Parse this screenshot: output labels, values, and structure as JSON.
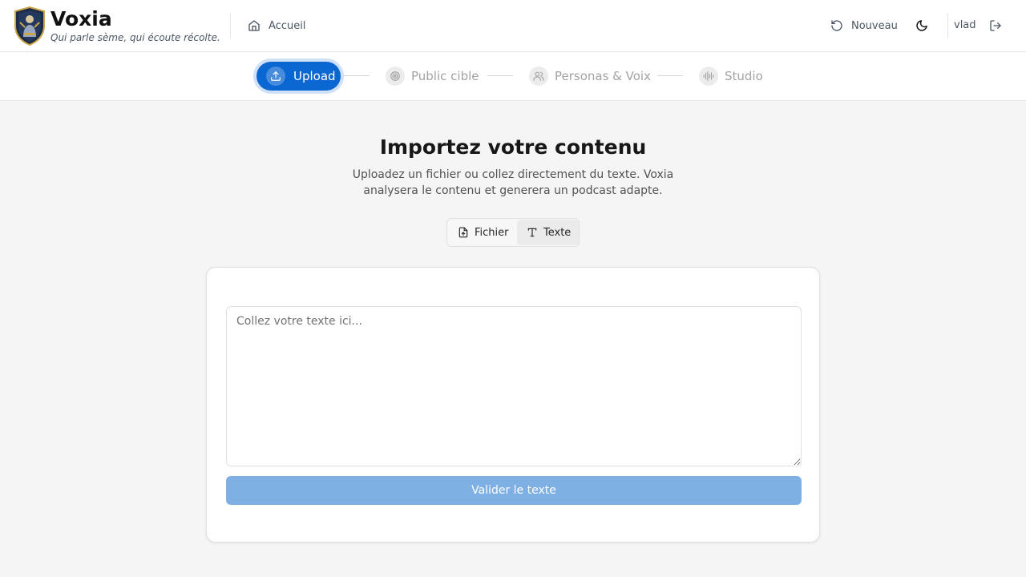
{
  "brand": {
    "name": "Voxia",
    "tagline": "Qui parle sème, qui écoute récolte.",
    "logo_icon": "shield-logo-icon"
  },
  "header": {
    "home_label": "Accueil",
    "home_icon": "home-icon",
    "new_label": "Nouveau",
    "new_icon": "refresh-icon",
    "theme_icon": "moon-icon",
    "user_name": "vlad",
    "logout_icon": "logout-icon"
  },
  "stepper": {
    "steps": [
      {
        "label": "Upload",
        "icon": "upload-icon",
        "state": "active"
      },
      {
        "label": "Public cible",
        "icon": "target-icon",
        "state": "pending"
      },
      {
        "label": "Personas & Voix",
        "icon": "users-icon",
        "state": "pending"
      },
      {
        "label": "Studio",
        "icon": "audio-wave-icon",
        "state": "pending"
      }
    ]
  },
  "main": {
    "title": "Importez votre contenu",
    "subtitle": "Uploadez un fichier ou collez directement du texte. Voxia analysera le contenu et generera un podcast adapte.",
    "modes": [
      {
        "label": "Fichier",
        "icon": "file-upload-icon",
        "selected": false
      },
      {
        "label": "Texte",
        "icon": "text-icon",
        "selected": true
      }
    ],
    "text_input": {
      "value": "",
      "placeholder": "Collez votre texte ici..."
    },
    "submit_label": "Valider le texte"
  },
  "colors": {
    "accent": "#0a66d1",
    "accent_disabled": "#7fb0e4",
    "background": "#f5f5f5"
  }
}
